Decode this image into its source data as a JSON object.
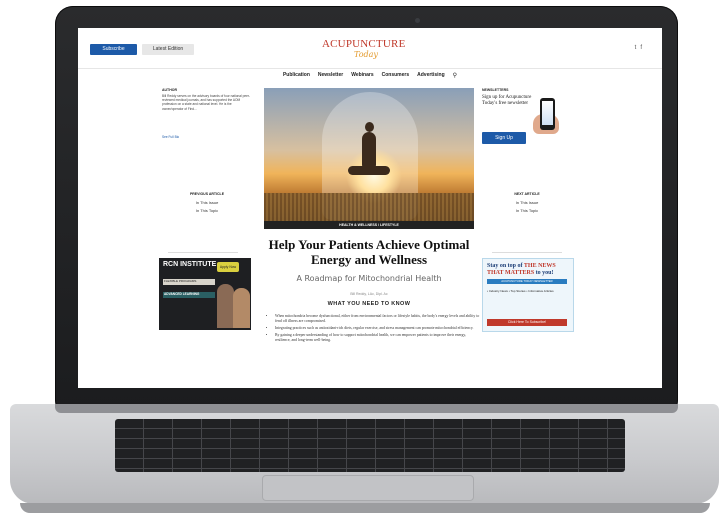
{
  "header": {
    "subscribe_label": "Subscribe",
    "latest_edition_label": "Latest Edition",
    "logo_text": "ACUPUNCTURE",
    "logo_sub": "Today",
    "social": [
      "t",
      "f"
    ]
  },
  "nav": {
    "items": [
      "Publication",
      "Newsletter",
      "Webinars",
      "Consumers",
      "Advertising"
    ],
    "search_icon": "search-icon"
  },
  "article": {
    "category": "HEALTH & WELLNESS / LIFESTYLE",
    "title": "Help Your Patients Achieve Optimal Energy and Wellness",
    "subtitle": "A Roadmap for Mitochondrial Health",
    "byline": "Bill Reddy, LAc, Dipl. Ac",
    "wyntk": "WHAT YOU NEED TO KNOW",
    "bullets": [
      "When mitochondria become dysfunctional, either from environmental factors or lifestyle habits, the body's energy levels and ability to fend off illness are compromised.",
      "Integrating practices such as antioxidant-rich diets, regular exercise, and stress management can promote mitochondrial efficiency.",
      "By gaining a deeper understanding of how to support mitochondrial health, we can empower patients to improve their energy, resilience, and long-term well-being."
    ]
  },
  "author": {
    "heading": "AUTHOR",
    "text": "Bill Reddy serves on the advisory boards of four national peer-reviewed medical journals, and has supported the AOM profession on a state and national level. He is the owner/operator of Find...",
    "link": "See Full Bio"
  },
  "prev": {
    "heading": "PREVIOUS ARTICLE",
    "in_issue": "In This Issue",
    "in_topic": "In This Topic"
  },
  "next": {
    "heading": "NEXT ARTICLE",
    "in_issue": "In This Issue",
    "in_topic": "In This Topic"
  },
  "newsletter": {
    "heading": "NEWSLETTERS",
    "text": "Sign up for Acupuncture Today's free newsletter",
    "signup_label": "Sign Up"
  },
  "ad_left": {
    "brand": "RCN INSTITUTE",
    "box1": "FLEXIBLE PROGRAMS",
    "box2": "ADVANCED LEARNING",
    "cta": "Apply Now"
  },
  "ad_right": {
    "headline_a": "Stay on top of ",
    "headline_red": "THE NEWS THAT MATTERS",
    "headline_b": " to you!",
    "bar": "ACUPUNCTURE TODAY NEWSLETTER",
    "list": "• Industry News  • Top Stories  • Informative Articles",
    "cta": "Click Here To Subscribe!"
  }
}
